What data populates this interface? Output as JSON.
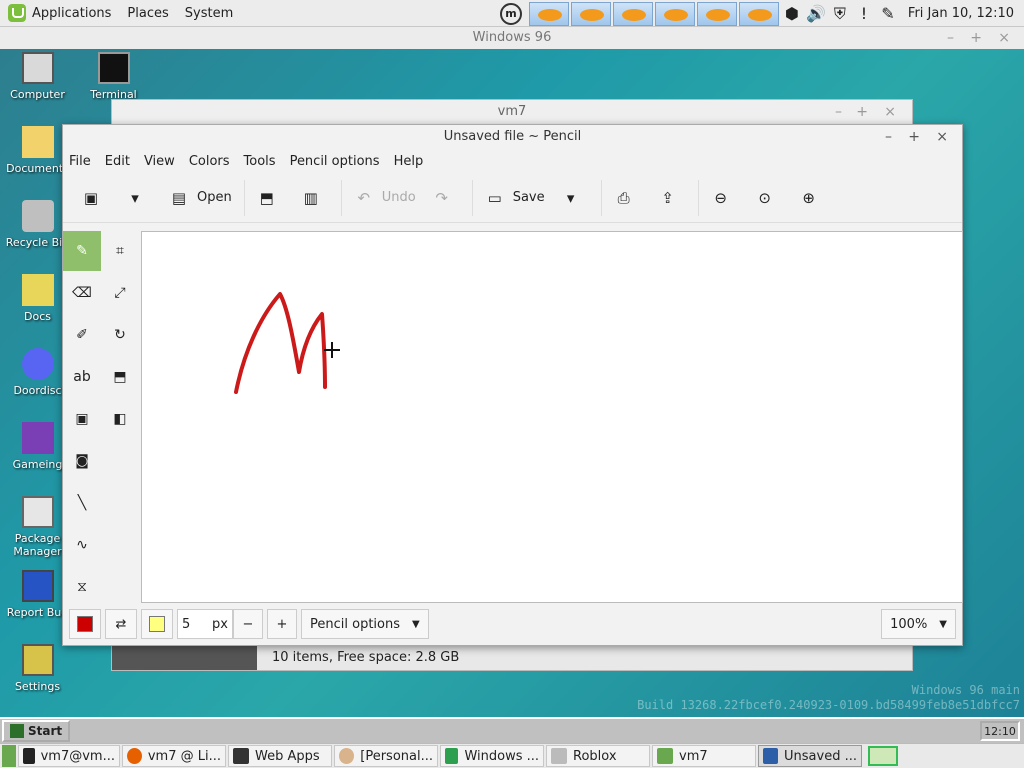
{
  "top_panel": {
    "menus": [
      "Applications",
      "Places",
      "System"
    ],
    "tray_icons": [
      "fish-icon",
      "fish-icon",
      "fish-icon",
      "fish-icon",
      "fish-icon",
      "fish-icon"
    ],
    "clock": "Fri Jan 10, 12:10"
  },
  "w96_window_title": "Windows 96",
  "desktop_icons": [
    {
      "label": "Computer"
    },
    {
      "label": "Terminal"
    },
    {
      "label": "Documents"
    },
    {
      "label": "Recycle Bin"
    },
    {
      "label": "Docs"
    },
    {
      "label": "Doordisc"
    },
    {
      "label": "Gameing"
    },
    {
      "label": "Package Manager"
    },
    {
      "label": "Report Bug"
    },
    {
      "label": "Settings"
    }
  ],
  "vm7": {
    "title": "vm7",
    "status": "10 items, Free space: 2.8 GB"
  },
  "pencil": {
    "title": "Unsaved file ~ Pencil",
    "menus": [
      "File",
      "Edit",
      "View",
      "Colors",
      "Tools",
      "Pencil options",
      "Help"
    ],
    "toolbar": {
      "open_label": "Open",
      "undo_label": "Undo",
      "save_label": "Save"
    },
    "size_value": "5",
    "size_unit": "px",
    "options_label": "Pencil options",
    "zoom": "100%",
    "primary_color": "#cc0000",
    "secondary_color": "#ffff80"
  },
  "watermark": {
    "line1": "Windows 96 main",
    "line2": "Build 13268.22fbcef0.240923-0109.bd58499feb8e51dbfcc7"
  },
  "w96_taskbar": {
    "start": "Start",
    "clock": "12:10"
  },
  "host_taskbar": {
    "items": [
      "vm7@vm...",
      "vm7 @ Li...",
      "Web Apps",
      "[Personal...",
      "Windows ...",
      "Roblox",
      "vm7",
      "Unsaved ..."
    ]
  }
}
